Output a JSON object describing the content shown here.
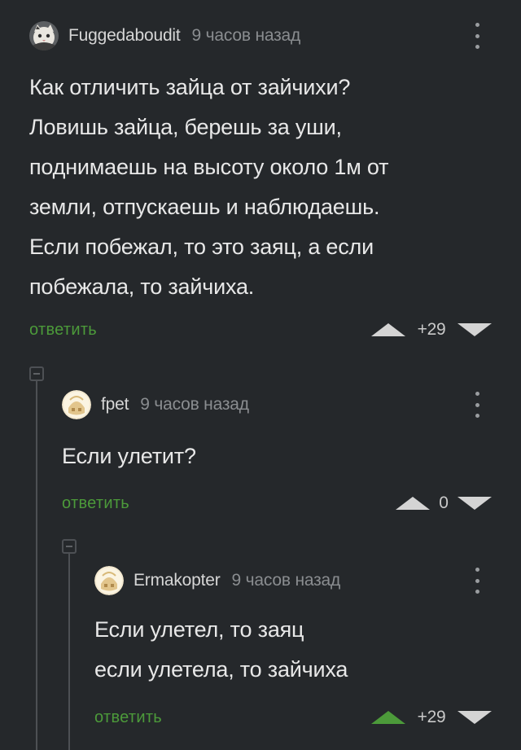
{
  "comments": [
    {
      "username": "Fuggedaboudit",
      "time": "9 часов назад",
      "avatar": "cat-avatar",
      "text_lines": [
        "Как отличить зайца от зайчихи?",
        "Ловишь зайца, берешь за уши,",
        "поднимаешь на высоту около 1м от",
        "земли, отпускаешь и наблюдаешь.",
        "Если побежал, то это заяц, а если",
        "побежала, то зайчиха."
      ],
      "reply_label": "ответить",
      "score": "+29",
      "upvoted": false
    },
    {
      "username": "fpet",
      "time": "9 часов назад",
      "avatar": "default-avatar",
      "text_lines": [
        "Если улетит?"
      ],
      "reply_label": "ответить",
      "score": "0",
      "upvoted": false
    },
    {
      "username": "Ermakopter",
      "time": "9 часов назад",
      "avatar": "default-avatar",
      "text_lines": [
        "Если улетел, то заяц",
        "если улетела, то зайчиха"
      ],
      "reply_label": "ответить",
      "score": "+29",
      "upvoted": true
    }
  ],
  "colors": {
    "background": "#25282b",
    "reply_link": "#4c9a3a",
    "vote_inactive": "#d4d4d4",
    "vote_active": "#4c9a3a",
    "thread_line": "#4d5054"
  },
  "icons": {
    "menu": "kebab-menu-icon",
    "upvote": "upvote-arrow-icon",
    "downvote": "downvote-arrow-icon",
    "collapse": "collapse-thread-icon"
  }
}
